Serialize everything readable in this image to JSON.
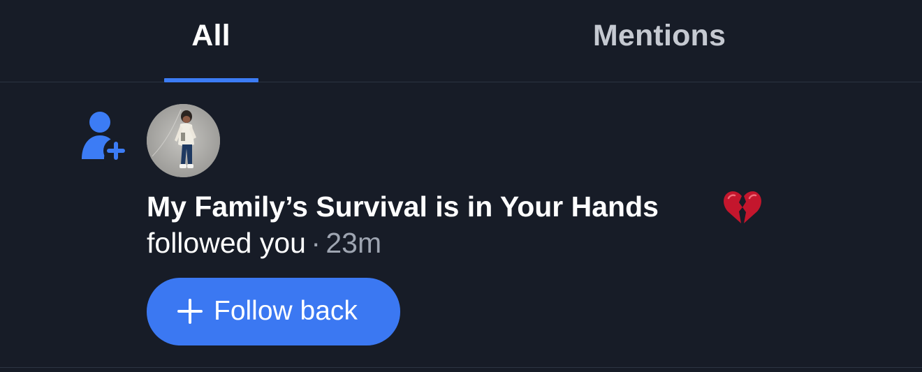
{
  "tabs": [
    {
      "label": "All",
      "selected": true
    },
    {
      "label": "Mentions",
      "selected": false
    }
  ],
  "notification": {
    "type_icon": "person-plus-icon",
    "avatar_icon": "profile-photo-child",
    "display_name": "My Family’s Survival is in Your Hands",
    "name_emoji_icon": "broken-heart-icon",
    "action": "followed you",
    "separator": "·",
    "time_ago": "23m",
    "follow_back": {
      "icon": "plus-icon",
      "label": "Follow back"
    }
  },
  "colors": {
    "background": "#171c27",
    "accent": "#3c7cf5",
    "divider": "#2c3442",
    "muted_text": "#9ea5b1",
    "inactive_tab": "#c5c9d1",
    "broken_heart": "#c4162d"
  }
}
